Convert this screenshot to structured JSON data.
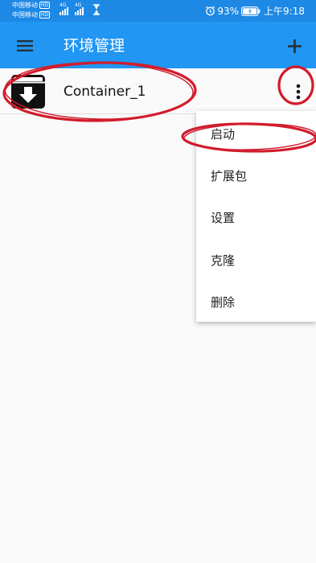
{
  "status_bar": {
    "carrier_1": "中国移动",
    "carrier_2": "中国移动",
    "hd_label": "HD",
    "network_type": "4G",
    "battery_percent": "93%",
    "time": "上午9:18"
  },
  "app_bar": {
    "title": "环境管理",
    "menu_icon": "hamburger-menu-icon",
    "add_icon": "plus-icon",
    "background_color": "#2196f3"
  },
  "list": {
    "items": [
      {
        "name": "Container_1",
        "icon": "download-box-icon",
        "more_icon": "vertical-dots-icon"
      }
    ]
  },
  "popup_menu": {
    "items": [
      {
        "label": "启动"
      },
      {
        "label": "扩展包"
      },
      {
        "label": "设置"
      },
      {
        "label": "克隆"
      },
      {
        "label": "删除"
      }
    ]
  },
  "annotation_color": "#d21c2c"
}
